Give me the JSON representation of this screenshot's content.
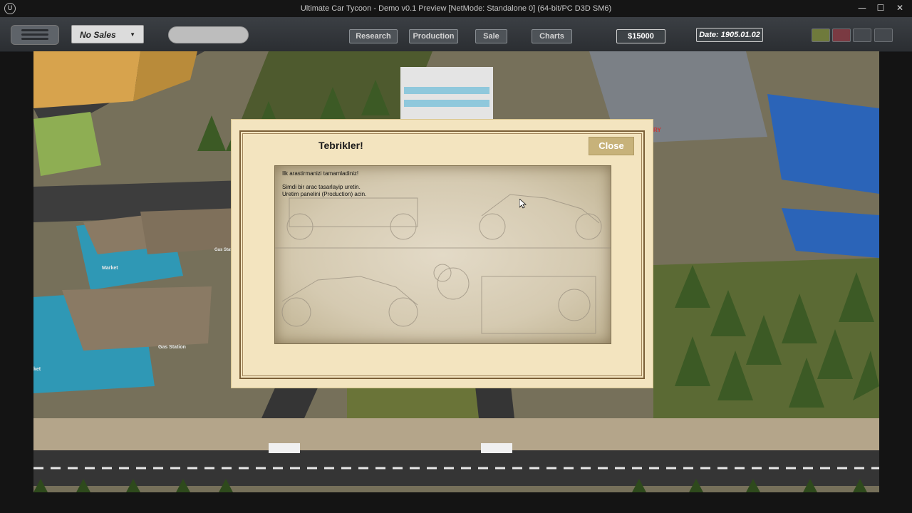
{
  "window": {
    "title": "Ultimate Car Tycoon - Demo v0.1 Preview [NetMode: Standalone 0]  (64-bit/PC D3D SM6)",
    "logo_icon": "unreal-logo-icon",
    "controls": [
      "minimize-icon",
      "maximize-icon",
      "close-icon"
    ]
  },
  "toolbar": {
    "menu_icon": "hamburger-menu-icon",
    "sales_select": {
      "value": "No Sales"
    },
    "nav": {
      "research": "Research",
      "production": "Production",
      "sale": "Sale",
      "charts": "Charts"
    },
    "money": "$15000",
    "date": "Date: 1905.01.02",
    "speed_controls": [
      {
        "name": "pause",
        "color": "#6f7a3c"
      },
      {
        "name": "stop",
        "color": "#7a3a42"
      },
      {
        "name": "play",
        "color": "#44484d"
      },
      {
        "name": "fast-forward",
        "color": "#44484d"
      }
    ]
  },
  "world_labels": {
    "market": "Market",
    "gas_station": "Gas Station",
    "gas_station_2": "Gas Stati",
    "market_2": "ket",
    "factory_sign": "RY"
  },
  "dialog": {
    "title": "Tebrikler!",
    "close_label": "Close",
    "message": {
      "line1": "Ilk arastirmanizi tamamladiniz!",
      "line2": "Simdi bir arac tasarlayip uretin.",
      "line3": "Uretim panelini (Production) acin."
    }
  },
  "colors": {
    "dialog_bg": "#f3e4bf",
    "dialog_border": "#7b6038",
    "close_button": "#c7b27a",
    "toolbar": "#34383c"
  }
}
